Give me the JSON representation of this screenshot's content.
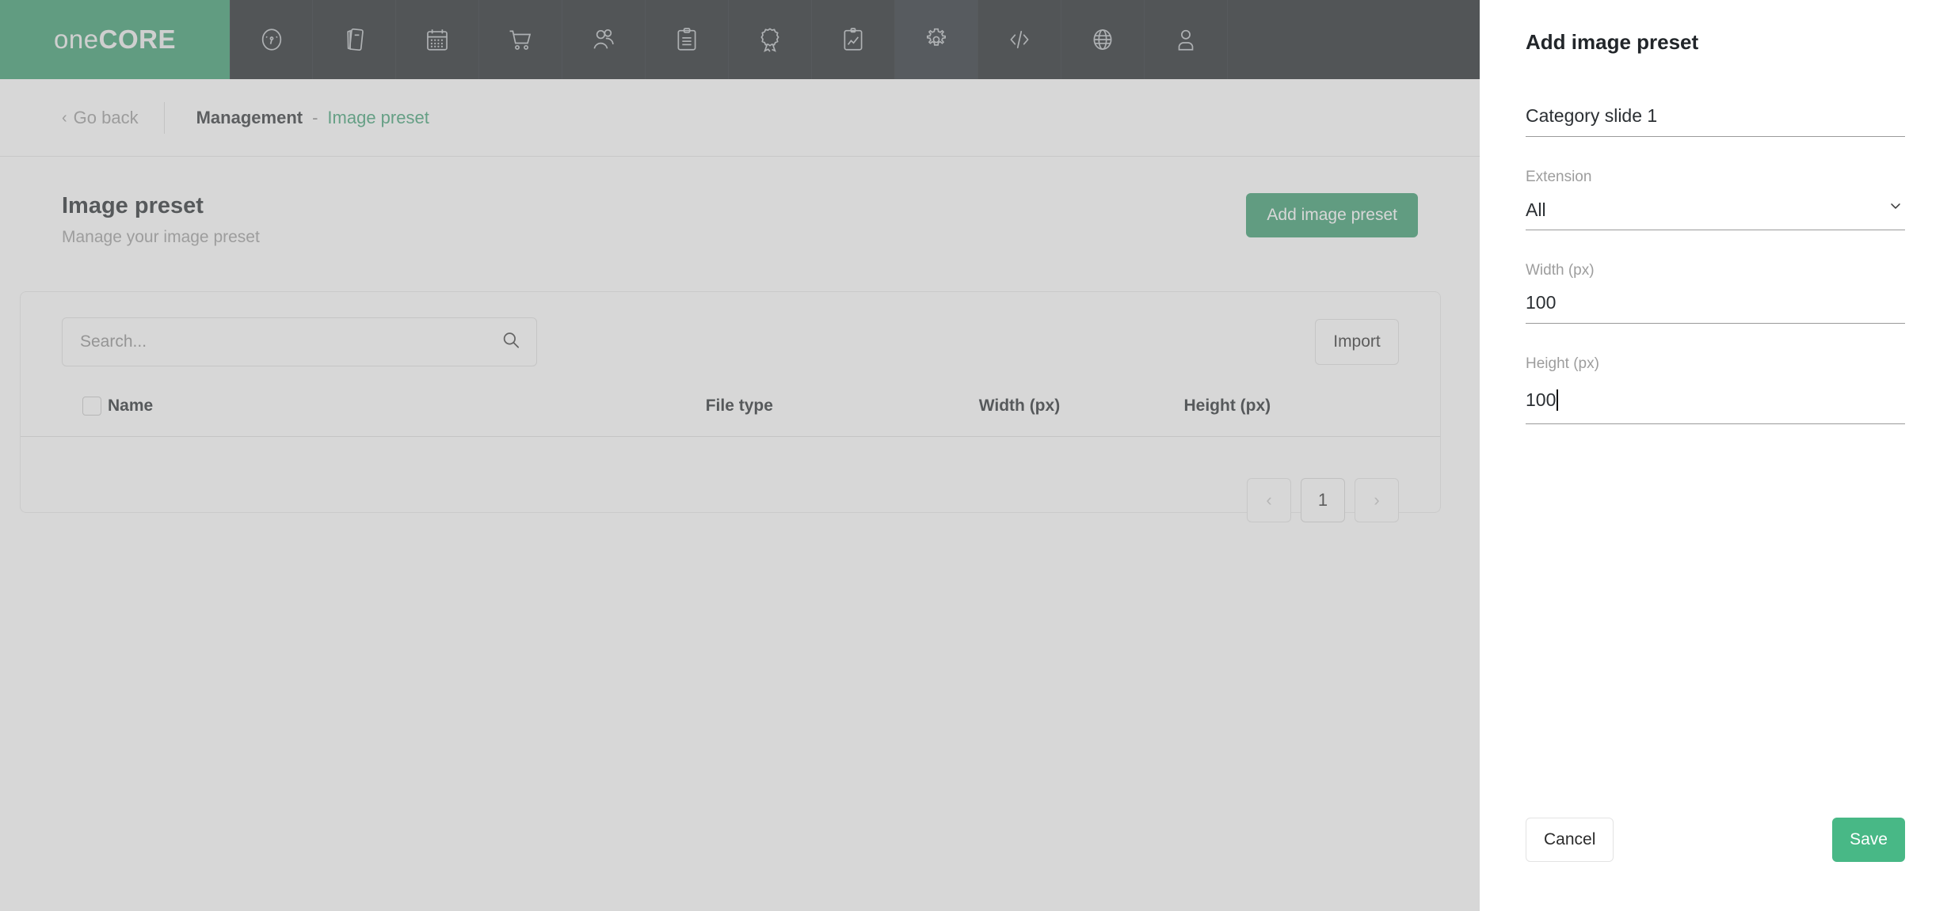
{
  "brand": {
    "light": "one",
    "bold": "CORE"
  },
  "nav": {
    "items": [
      {
        "icon": "dashboard-gauge-icon",
        "active": false
      },
      {
        "icon": "mobile-pages-icon",
        "active": false
      },
      {
        "icon": "calendar-icon",
        "active": false
      },
      {
        "icon": "shopping-cart-icon",
        "active": false
      },
      {
        "icon": "users-icon",
        "active": false
      },
      {
        "icon": "clipboard-list-icon",
        "active": false
      },
      {
        "icon": "award-ribbon-icon",
        "active": false
      },
      {
        "icon": "report-chart-icon",
        "active": false
      },
      {
        "icon": "gear-icon",
        "active": true
      },
      {
        "icon": "code-brackets-icon",
        "active": false
      },
      {
        "icon": "globe-icon",
        "active": false
      },
      {
        "icon": "user-account-icon",
        "active": false
      }
    ]
  },
  "breadcrumb": {
    "go_back": "Go back",
    "root": "Management",
    "separator": "-",
    "current": "Image preset"
  },
  "page": {
    "title": "Image preset",
    "subtitle": "Manage your image preset",
    "add_button": "Add image preset"
  },
  "toolbar": {
    "search_placeholder": "Search...",
    "search_value": "",
    "import_label": "Import"
  },
  "table": {
    "columns": [
      "Name",
      "File type",
      "Width (px)",
      "Height (px)"
    ],
    "rows": []
  },
  "pagination": {
    "prev": "‹",
    "current_page": "1",
    "next": "›"
  },
  "drawer": {
    "title": "Add image preset",
    "fields": {
      "name": {
        "label": "",
        "value": "Category slide 1",
        "placeholder": ""
      },
      "extension": {
        "label": "Extension",
        "value": "All",
        "options": [
          "All"
        ]
      },
      "width": {
        "label": "Width (px)",
        "value": "100"
      },
      "height": {
        "label": "Height (px)",
        "value": "100"
      }
    },
    "cancel_label": "Cancel",
    "save_label": "Save"
  },
  "colors": {
    "brand_green": "#349a6b",
    "primary_button": "#359a6c",
    "save_button": "#48b886",
    "navbar": "#1a1f24",
    "crumb_current": "#3c9f72"
  }
}
